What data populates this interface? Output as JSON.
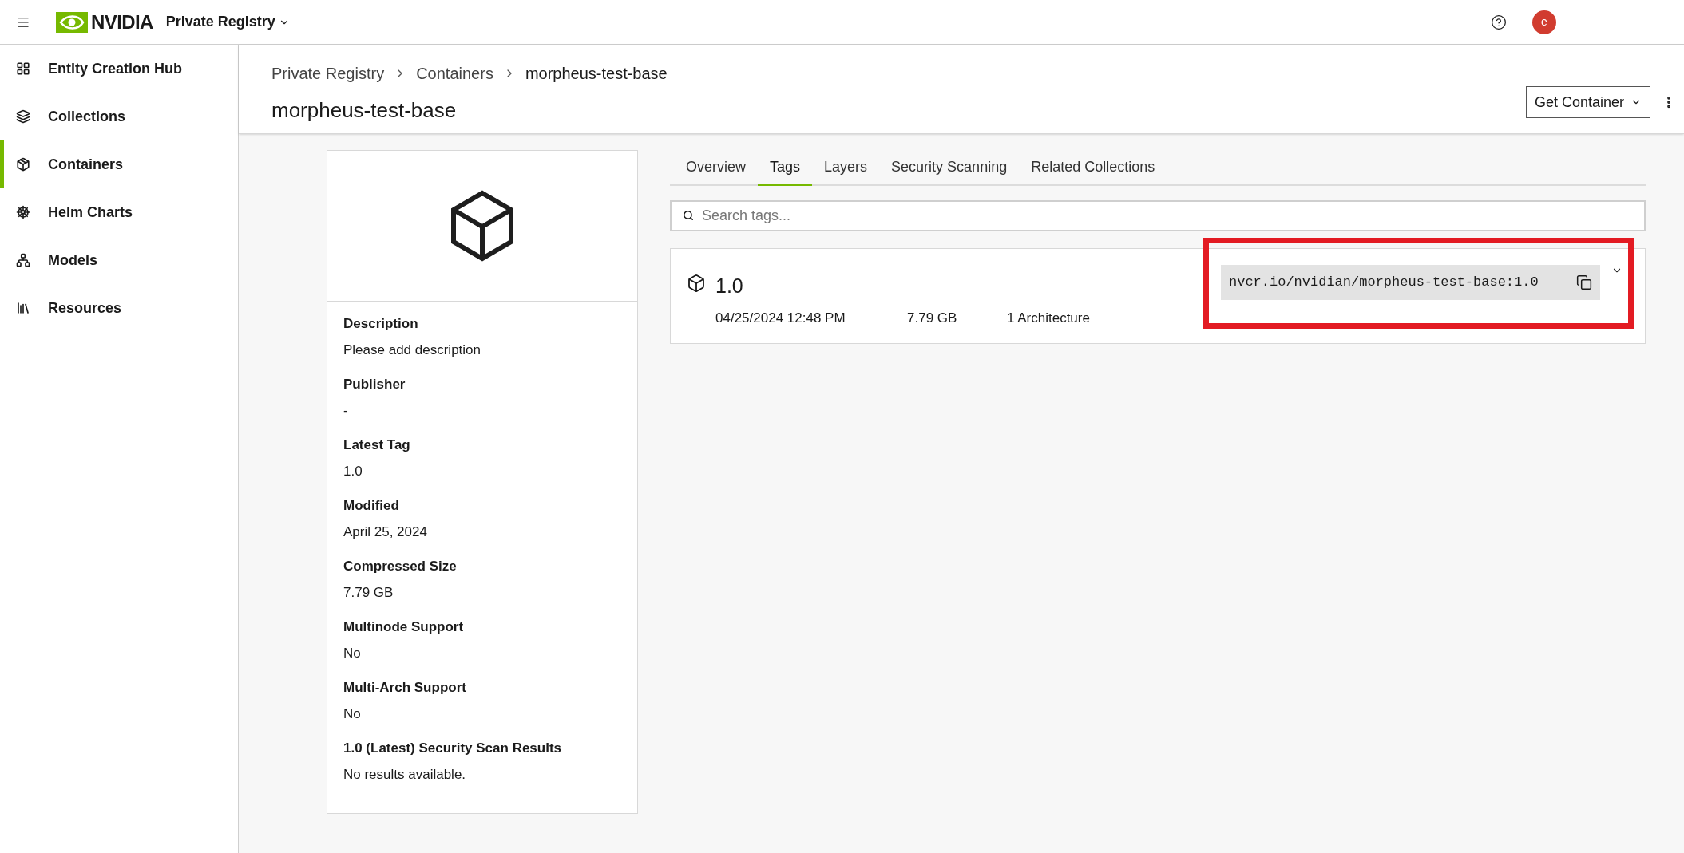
{
  "topbar": {
    "brand": "NVIDIA",
    "product": "Private Registry",
    "avatar": "e"
  },
  "sidebar": {
    "items": [
      {
        "label": "Entity Creation Hub",
        "selected": false
      },
      {
        "label": "Collections",
        "selected": false
      },
      {
        "label": "Containers",
        "selected": true
      },
      {
        "label": "Helm Charts",
        "selected": false
      },
      {
        "label": "Models",
        "selected": false
      },
      {
        "label": "Resources",
        "selected": false
      }
    ]
  },
  "breadcrumb": [
    "Private Registry",
    "Containers",
    "morpheus-test-base"
  ],
  "title": "morpheus-test-base",
  "get_button": "Get Container",
  "details": [
    {
      "label": "Description",
      "value": "Please add description"
    },
    {
      "label": "Publisher",
      "value": "-"
    },
    {
      "label": "Latest Tag",
      "value": "1.0"
    },
    {
      "label": "Modified",
      "value": "April 25, 2024"
    },
    {
      "label": "Compressed Size",
      "value": "7.79 GB"
    },
    {
      "label": "Multinode Support",
      "value": "No"
    },
    {
      "label": "Multi-Arch Support",
      "value": "No"
    },
    {
      "label": "1.0 (Latest) Security Scan Results",
      "value": "No results available."
    }
  ],
  "tabs": [
    {
      "label": "Overview",
      "selected": false
    },
    {
      "label": "Tags",
      "selected": true
    },
    {
      "label": "Layers",
      "selected": false
    },
    {
      "label": "Security Scanning",
      "selected": false
    },
    {
      "label": "Related Collections",
      "selected": false
    }
  ],
  "search": {
    "placeholder": "Search tags..."
  },
  "tags": [
    {
      "name": "1.0",
      "date": "04/25/2024 12:48 PM",
      "size": "7.79 GB",
      "architectures": "1 Architecture",
      "pull_command": "nvcr.io/nvidian/morpheus-test-base:1.0",
      "highlighted": true,
      "expanded": false
    }
  ]
}
